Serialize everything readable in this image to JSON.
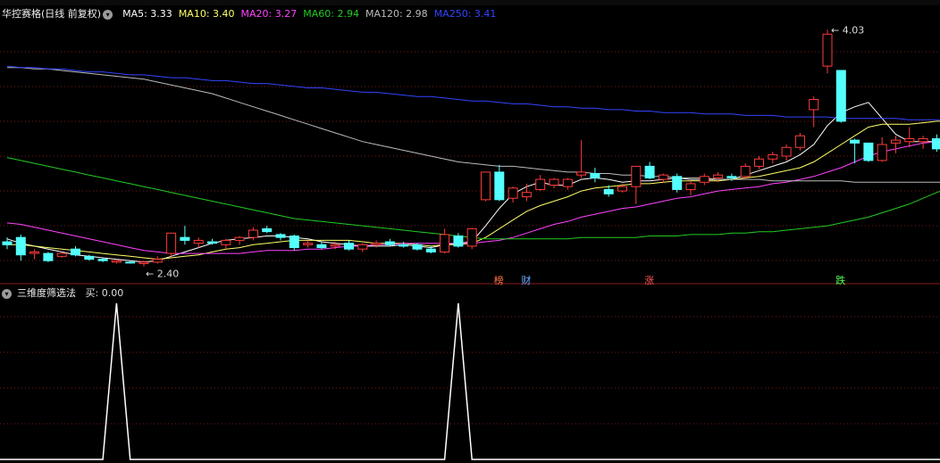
{
  "main_legend": {
    "stock_title": "华控赛格(日线 前复权)",
    "ma": [
      {
        "label": "MA5:",
        "value": "3.33",
        "color": "#ffffff"
      },
      {
        "label": "MA10:",
        "value": "3.40",
        "color": "#ffff66"
      },
      {
        "label": "MA20:",
        "value": "3.27",
        "color": "#ff44ff"
      },
      {
        "label": "MA60:",
        "value": "2.94",
        "color": "#22cc22"
      },
      {
        "label": "MA120:",
        "value": "2.98",
        "color": "#bbbbbb"
      },
      {
        "label": "MA250:",
        "value": "3.41",
        "color": "#3344ff"
      }
    ]
  },
  "sub_legend": {
    "indicator_title": "三维度筛选法",
    "buy_label": "买:",
    "buy_value": "0.00"
  },
  "tags": [
    {
      "text": "榜",
      "color": "#ff7744"
    },
    {
      "text": "财",
      "color": "#66aaff"
    },
    {
      "text": "涨",
      "color": "#ff5555"
    },
    {
      "text": "跌",
      "color": "#55ff55"
    }
  ],
  "chart_data": {
    "type": "candlestick",
    "price_annotations": {
      "high": "4.03",
      "low": "2.40"
    },
    "candles": [
      {
        "o": 2.57,
        "h": 2.6,
        "l": 2.52,
        "c": 2.55,
        "up": false
      },
      {
        "o": 2.6,
        "h": 2.62,
        "l": 2.44,
        "c": 2.48,
        "up": false
      },
      {
        "o": 2.49,
        "h": 2.52,
        "l": 2.45,
        "c": 2.5,
        "up": true
      },
      {
        "o": 2.49,
        "h": 2.5,
        "l": 2.43,
        "c": 2.44,
        "up": false
      },
      {
        "o": 2.47,
        "h": 2.5,
        "l": 2.46,
        "c": 2.49,
        "up": true
      },
      {
        "o": 2.52,
        "h": 2.54,
        "l": 2.47,
        "c": 2.48,
        "up": false
      },
      {
        "o": 2.47,
        "h": 2.48,
        "l": 2.44,
        "c": 2.45,
        "up": false
      },
      {
        "o": 2.45,
        "h": 2.46,
        "l": 2.43,
        "c": 2.44,
        "up": false
      },
      {
        "o": 2.43,
        "h": 2.45,
        "l": 2.42,
        "c": 2.44,
        "up": true
      },
      {
        "o": 2.43,
        "h": 2.44,
        "l": 2.42,
        "c": 2.43,
        "up": false
      },
      {
        "o": 2.42,
        "h": 2.44,
        "l": 2.4,
        "c": 2.43,
        "up": true
      },
      {
        "o": 2.43,
        "h": 2.47,
        "l": 2.42,
        "c": 2.45,
        "up": true
      },
      {
        "o": 2.49,
        "h": 2.63,
        "l": 2.47,
        "c": 2.63,
        "up": true
      },
      {
        "o": 2.6,
        "h": 2.68,
        "l": 2.55,
        "c": 2.58,
        "up": false
      },
      {
        "o": 2.56,
        "h": 2.6,
        "l": 2.53,
        "c": 2.58,
        "up": true
      },
      {
        "o": 2.57,
        "h": 2.59,
        "l": 2.55,
        "c": 2.56,
        "up": false
      },
      {
        "o": 2.55,
        "h": 2.59,
        "l": 2.52,
        "c": 2.58,
        "up": true
      },
      {
        "o": 2.58,
        "h": 2.61,
        "l": 2.55,
        "c": 2.6,
        "up": true
      },
      {
        "o": 2.6,
        "h": 2.67,
        "l": 2.58,
        "c": 2.65,
        "up": true
      },
      {
        "o": 2.66,
        "h": 2.68,
        "l": 2.63,
        "c": 2.64,
        "up": false
      },
      {
        "o": 2.62,
        "h": 2.63,
        "l": 2.58,
        "c": 2.6,
        "up": false
      },
      {
        "o": 2.61,
        "h": 2.62,
        "l": 2.51,
        "c": 2.53,
        "up": false
      },
      {
        "o": 2.56,
        "h": 2.58,
        "l": 2.53,
        "c": 2.55,
        "up": true
      },
      {
        "o": 2.55,
        "h": 2.57,
        "l": 2.52,
        "c": 2.53,
        "up": false
      },
      {
        "o": 2.54,
        "h": 2.57,
        "l": 2.52,
        "c": 2.55,
        "up": true
      },
      {
        "o": 2.56,
        "h": 2.58,
        "l": 2.51,
        "c": 2.52,
        "up": false
      },
      {
        "o": 2.52,
        "h": 2.56,
        "l": 2.5,
        "c": 2.55,
        "up": true
      },
      {
        "o": 2.55,
        "h": 2.58,
        "l": 2.53,
        "c": 2.56,
        "up": true
      },
      {
        "o": 2.57,
        "h": 2.59,
        "l": 2.54,
        "c": 2.55,
        "up": false
      },
      {
        "o": 2.55,
        "h": 2.57,
        "l": 2.53,
        "c": 2.54,
        "up": false
      },
      {
        "o": 2.55,
        "h": 2.56,
        "l": 2.51,
        "c": 2.52,
        "up": false
      },
      {
        "o": 2.52,
        "h": 2.54,
        "l": 2.49,
        "c": 2.5,
        "up": false
      },
      {
        "o": 2.5,
        "h": 2.66,
        "l": 2.49,
        "c": 2.62,
        "up": true
      },
      {
        "o": 2.61,
        "h": 2.63,
        "l": 2.53,
        "c": 2.54,
        "up": false
      },
      {
        "o": 2.54,
        "h": 2.66,
        "l": 2.52,
        "c": 2.66,
        "up": true
      },
      {
        "o": 2.86,
        "h": 3.05,
        "l": 2.85,
        "c": 3.05,
        "up": true
      },
      {
        "o": 3.05,
        "h": 3.1,
        "l": 2.85,
        "c": 2.86,
        "up": false
      },
      {
        "o": 2.87,
        "h": 2.95,
        "l": 2.84,
        "c": 2.94,
        "up": true
      },
      {
        "o": 2.88,
        "h": 2.97,
        "l": 2.85,
        "c": 2.91,
        "up": true
      },
      {
        "o": 2.93,
        "h": 3.03,
        "l": 2.92,
        "c": 3.0,
        "up": true
      },
      {
        "o": 2.96,
        "h": 3.01,
        "l": 2.94,
        "c": 3.0,
        "up": true
      },
      {
        "o": 2.95,
        "h": 3.01,
        "l": 2.93,
        "c": 3.0,
        "up": true
      },
      {
        "o": 3.03,
        "h": 3.27,
        "l": 3.01,
        "c": 3.05,
        "up": true
      },
      {
        "o": 3.04,
        "h": 3.08,
        "l": 2.98,
        "c": 3.01,
        "up": false
      },
      {
        "o": 2.93,
        "h": 2.96,
        "l": 2.88,
        "c": 2.9,
        "up": false
      },
      {
        "o": 2.92,
        "h": 2.97,
        "l": 2.91,
        "c": 2.95,
        "up": true
      },
      {
        "o": 2.95,
        "h": 3.09,
        "l": 2.83,
        "c": 3.09,
        "up": true
      },
      {
        "o": 3.09,
        "h": 3.12,
        "l": 3.0,
        "c": 3.01,
        "up": false
      },
      {
        "o": 3.0,
        "h": 3.04,
        "l": 2.98,
        "c": 3.03,
        "up": true
      },
      {
        "o": 3.02,
        "h": 3.04,
        "l": 2.91,
        "c": 2.93,
        "up": false
      },
      {
        "o": 2.93,
        "h": 2.99,
        "l": 2.89,
        "c": 2.97,
        "up": true
      },
      {
        "o": 2.98,
        "h": 3.04,
        "l": 2.96,
        "c": 3.02,
        "up": true
      },
      {
        "o": 3.01,
        "h": 3.05,
        "l": 2.98,
        "c": 3.03,
        "up": true
      },
      {
        "o": 3.02,
        "h": 3.04,
        "l": 2.99,
        "c": 3.01,
        "up": false
      },
      {
        "o": 3.02,
        "h": 3.11,
        "l": 3.0,
        "c": 3.09,
        "up": true
      },
      {
        "o": 3.09,
        "h": 3.16,
        "l": 3.07,
        "c": 3.14,
        "up": true
      },
      {
        "o": 3.14,
        "h": 3.19,
        "l": 3.11,
        "c": 3.17,
        "up": true
      },
      {
        "o": 3.16,
        "h": 3.24,
        "l": 3.13,
        "c": 3.22,
        "up": true
      },
      {
        "o": 3.22,
        "h": 3.32,
        "l": 3.2,
        "c": 3.3,
        "up": true
      },
      {
        "o": 3.48,
        "h": 3.57,
        "l": 3.36,
        "c": 3.55,
        "up": true
      },
      {
        "o": 3.78,
        "h": 4.03,
        "l": 3.73,
        "c": 4.0,
        "up": true
      },
      {
        "o": 3.75,
        "h": 3.75,
        "l": 3.39,
        "c": 3.4,
        "up": false
      },
      {
        "o": 3.27,
        "h": 3.28,
        "l": 3.11,
        "c": 3.25,
        "up": false
      },
      {
        "o": 3.25,
        "h": 3.25,
        "l": 3.12,
        "c": 3.13,
        "up": false
      },
      {
        "o": 3.13,
        "h": 3.29,
        "l": 3.12,
        "c": 3.24,
        "up": true
      },
      {
        "o": 3.25,
        "h": 3.3,
        "l": 3.18,
        "c": 3.27,
        "up": true
      },
      {
        "o": 3.26,
        "h": 3.36,
        "l": 3.22,
        "c": 3.28,
        "up": true
      },
      {
        "o": 3.26,
        "h": 3.3,
        "l": 3.21,
        "c": 3.28,
        "up": true
      },
      {
        "o": 3.28,
        "h": 3.31,
        "l": 3.19,
        "c": 3.21,
        "up": false
      },
      {
        "o": 3.18,
        "h": 3.26,
        "l": 3.16,
        "c": 3.24,
        "up": true
      }
    ],
    "ma_lines": [
      {
        "name": "MA5",
        "color": "#ffffff",
        "values": [
          2.59,
          2.56,
          2.54,
          2.52,
          2.5,
          2.48,
          2.47,
          2.46,
          2.45,
          2.44,
          2.43,
          2.44,
          2.47,
          2.5,
          2.53,
          2.56,
          2.58,
          2.59,
          2.6,
          2.61,
          2.61,
          2.6,
          2.59,
          2.57,
          2.56,
          2.55,
          2.54,
          2.54,
          2.54,
          2.55,
          2.54,
          2.53,
          2.55,
          2.56,
          2.57,
          2.68,
          2.8,
          2.9,
          2.95,
          2.98,
          2.96,
          2.96,
          3.0,
          3.01,
          3.0,
          2.98,
          2.99,
          2.99,
          3.0,
          3.01,
          3.0,
          3.0,
          3.0,
          3.0,
          3.03,
          3.06,
          3.09,
          3.12,
          3.17,
          3.24,
          3.37,
          3.46,
          3.5,
          3.53,
          3.42,
          3.31,
          3.26,
          3.26,
          3.26,
          3.25
        ]
      },
      {
        "name": "MA10",
        "color": "#ffff66",
        "values": [
          2.55,
          2.55,
          2.54,
          2.53,
          2.52,
          2.51,
          2.5,
          2.49,
          2.48,
          2.47,
          2.46,
          2.45,
          2.46,
          2.47,
          2.48,
          2.5,
          2.52,
          2.53,
          2.55,
          2.56,
          2.57,
          2.58,
          2.58,
          2.58,
          2.58,
          2.58,
          2.57,
          2.56,
          2.56,
          2.56,
          2.55,
          2.54,
          2.55,
          2.55,
          2.56,
          2.6,
          2.66,
          2.72,
          2.78,
          2.82,
          2.85,
          2.88,
          2.92,
          2.94,
          2.95,
          2.96,
          2.97,
          2.97,
          2.98,
          2.99,
          2.99,
          2.99,
          2.99,
          3.0,
          3.01,
          3.02,
          3.04,
          3.06,
          3.08,
          3.12,
          3.18,
          3.24,
          3.3,
          3.36,
          3.38,
          3.38,
          3.38,
          3.39,
          3.4,
          3.4
        ]
      },
      {
        "name": "MA20",
        "color": "#ff44ff",
        "values": [
          2.7,
          2.69,
          2.67,
          2.65,
          2.63,
          2.61,
          2.59,
          2.57,
          2.55,
          2.53,
          2.51,
          2.5,
          2.49,
          2.49,
          2.49,
          2.49,
          2.49,
          2.49,
          2.5,
          2.51,
          2.51,
          2.51,
          2.52,
          2.52,
          2.53,
          2.54,
          2.54,
          2.55,
          2.55,
          2.56,
          2.56,
          2.56,
          2.56,
          2.56,
          2.56,
          2.57,
          2.58,
          2.6,
          2.63,
          2.66,
          2.69,
          2.71,
          2.74,
          2.76,
          2.78,
          2.8,
          2.81,
          2.83,
          2.85,
          2.87,
          2.88,
          2.9,
          2.92,
          2.93,
          2.94,
          2.95,
          2.97,
          2.98,
          3.0,
          3.02,
          3.05,
          3.08,
          3.12,
          3.16,
          3.19,
          3.21,
          3.23,
          3.25,
          3.26,
          3.27
        ]
      },
      {
        "name": "MA60",
        "color": "#22cc22",
        "values": [
          3.15,
          3.13,
          3.11,
          3.09,
          3.07,
          3.05,
          3.03,
          3.01,
          2.99,
          2.97,
          2.95,
          2.93,
          2.91,
          2.89,
          2.87,
          2.85,
          2.83,
          2.81,
          2.79,
          2.77,
          2.75,
          2.73,
          2.72,
          2.71,
          2.7,
          2.69,
          2.68,
          2.67,
          2.66,
          2.65,
          2.64,
          2.63,
          2.62,
          2.61,
          2.6,
          2.59,
          2.59,
          2.59,
          2.59,
          2.59,
          2.59,
          2.59,
          2.6,
          2.6,
          2.6,
          2.6,
          2.6,
          2.61,
          2.61,
          2.61,
          2.62,
          2.62,
          2.62,
          2.63,
          2.63,
          2.64,
          2.64,
          2.65,
          2.66,
          2.67,
          2.68,
          2.7,
          2.72,
          2.74,
          2.77,
          2.8,
          2.83,
          2.87,
          2.91,
          2.94
        ]
      },
      {
        "name": "MA120",
        "color": "#bbbbbb",
        "values": [
          3.77,
          3.77,
          3.76,
          3.76,
          3.75,
          3.74,
          3.73,
          3.72,
          3.71,
          3.7,
          3.69,
          3.67,
          3.65,
          3.63,
          3.61,
          3.59,
          3.56,
          3.53,
          3.5,
          3.47,
          3.44,
          3.41,
          3.38,
          3.35,
          3.32,
          3.29,
          3.26,
          3.24,
          3.22,
          3.2,
          3.18,
          3.16,
          3.14,
          3.12,
          3.11,
          3.1,
          3.09,
          3.09,
          3.08,
          3.07,
          3.06,
          3.05,
          3.05,
          3.04,
          3.04,
          3.03,
          3.03,
          3.02,
          3.02,
          3.01,
          3.01,
          3.01,
          3.0,
          3.0,
          3.0,
          3.0,
          2.99,
          2.99,
          2.99,
          2.99,
          2.99,
          2.99,
          2.98,
          2.98,
          2.98,
          2.98,
          2.98,
          2.98,
          2.98,
          2.98
        ]
      },
      {
        "name": "MA250",
        "color": "#3344ff",
        "values": [
          3.78,
          3.77,
          3.77,
          3.76,
          3.76,
          3.75,
          3.74,
          3.74,
          3.73,
          3.72,
          3.72,
          3.71,
          3.7,
          3.7,
          3.69,
          3.68,
          3.68,
          3.67,
          3.66,
          3.66,
          3.65,
          3.64,
          3.63,
          3.63,
          3.62,
          3.61,
          3.6,
          3.6,
          3.59,
          3.58,
          3.57,
          3.57,
          3.56,
          3.55,
          3.54,
          3.54,
          3.53,
          3.52,
          3.52,
          3.51,
          3.5,
          3.5,
          3.49,
          3.49,
          3.48,
          3.48,
          3.47,
          3.47,
          3.46,
          3.46,
          3.46,
          3.45,
          3.45,
          3.45,
          3.44,
          3.44,
          3.44,
          3.43,
          3.43,
          3.43,
          3.43,
          3.42,
          3.42,
          3.42,
          3.42,
          3.42,
          3.41,
          3.41,
          3.41,
          3.41
        ]
      }
    ],
    "buy_signal": [
      0,
      0,
      0,
      0,
      0,
      0,
      0,
      0,
      1,
      0,
      0,
      0,
      0,
      0,
      0,
      0,
      0,
      0,
      0,
      0,
      0,
      0,
      0,
      0,
      0,
      0,
      0,
      0,
      0,
      0,
      0,
      0,
      0,
      1,
      0,
      0,
      0,
      0,
      0,
      0,
      0,
      0,
      0,
      0,
      0,
      0,
      0,
      0,
      0,
      0,
      0,
      0,
      0,
      0,
      0,
      0,
      0,
      0,
      0,
      0,
      0,
      0,
      0,
      0,
      0,
      0,
      0,
      0,
      0,
      0
    ],
    "tag_positions": [
      {
        "tag": "榜",
        "index": 36
      },
      {
        "tag": "财",
        "index": 38
      },
      {
        "tag": "涨",
        "index": 47
      },
      {
        "tag": "跌",
        "index": 61
      }
    ]
  }
}
